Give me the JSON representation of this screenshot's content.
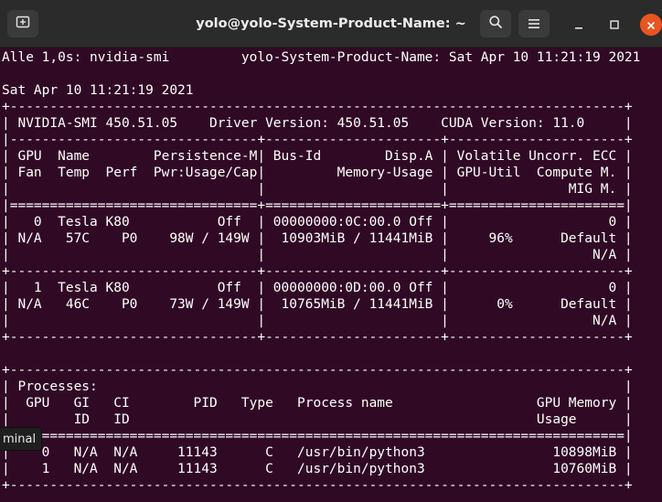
{
  "window": {
    "title": "yolo@yolo-System-Product-Name: ~"
  },
  "titlebar_icons": {
    "new_tab": "new-tab-icon",
    "search": "search-icon",
    "menu": "hamburger-menu-icon",
    "minimize": "minimize-icon",
    "maximize": "maximize-icon",
    "close": "close-icon"
  },
  "colors": {
    "terminal_bg": "#300a24",
    "titlebar_bg": "#2b2b2b",
    "close_button": "#e95420",
    "text": "#ffffff"
  },
  "terminal": {
    "lines": [
      "Alle 1,0s: nvidia-smi         yolo-System-Product-Name: Sat Apr 10 11:21:19 2021",
      "",
      "Sat Apr 10 11:21:19 2021",
      "+-----------------------------------------------------------------------------+",
      "| NVIDIA-SMI 450.51.05    Driver Version: 450.51.05    CUDA Version: 11.0     |",
      "|-------------------------------+----------------------+----------------------+",
      "| GPU  Name        Persistence-M| Bus-Id        Disp.A | Volatile Uncorr. ECC |",
      "| Fan  Temp  Perf  Pwr:Usage/Cap|         Memory-Usage | GPU-Util  Compute M. |",
      "|                               |                      |               MIG M. |",
      "|===============================+======================+======================|",
      "|   0  Tesla K80           Off  | 00000000:0C:00.0 Off |                    0 |",
      "| N/A   57C    P0    98W / 149W |  10903MiB / 11441MiB |     96%      Default |",
      "|                               |                      |                  N/A |",
      "+-------------------------------+----------------------+----------------------+",
      "|   1  Tesla K80           Off  | 00000000:0D:00.0 Off |                    0 |",
      "| N/A   46C    P0    73W / 149W |  10765MiB / 11441MiB |      0%      Default |",
      "|                               |                      |                  N/A |",
      "+-------------------------------+----------------------+----------------------+",
      "",
      "+-----------------------------------------------------------------------------+",
      "| Processes:                                                                  |",
      "|  GPU   GI   CI        PID   Type   Process name                  GPU Memory |",
      "|        ID   ID                                                   Usage      |",
      "|=============================================================================|",
      "|    0   N/A  N/A     11143      C   /usr/bin/python3                10898MiB |",
      "|    1   N/A  N/A     11143      C   /usr/bin/python3                10760MiB |",
      "+-----------------------------------------------------------------------------+"
    ]
  },
  "tooltip": {
    "text": "minal"
  }
}
